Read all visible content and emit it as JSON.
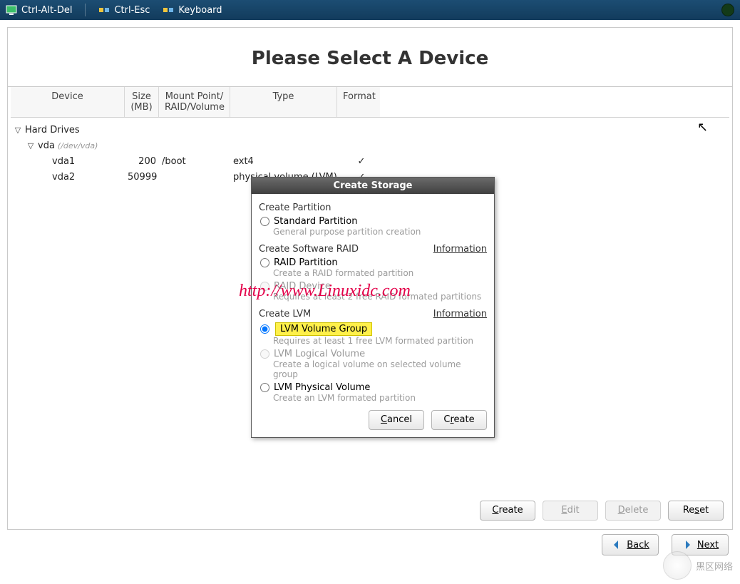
{
  "toolbar": {
    "items": [
      "Ctrl-Alt-Del",
      "Ctrl-Esc",
      "Keyboard"
    ]
  },
  "page": {
    "title": "Please Select A Device"
  },
  "columns": {
    "device": "Device",
    "size": "Size (MB)",
    "mount": "Mount Point/\nRAID/Volume",
    "type": "Type",
    "format": "Format"
  },
  "tree": {
    "hd_label": "Hard Drives",
    "vda": {
      "name": "vda",
      "dev": "(/dev/vda)"
    },
    "p1": {
      "name": "vda1",
      "size": "200",
      "mount": "/boot",
      "type": "ext4",
      "format": "✓"
    },
    "p2": {
      "name": "vda2",
      "size": "50999",
      "mount": "",
      "type": "physical volume (LVM)",
      "format": "✓"
    }
  },
  "buttons": {
    "create": "Create",
    "edit": "Edit",
    "delete": "Delete",
    "reset": "Reset",
    "back": "Back",
    "next": "Next"
  },
  "modal": {
    "title": "Create Storage",
    "sec_partition": "Create Partition",
    "std_part": "Standard Partition",
    "std_part_sub": "General purpose partition creation",
    "sec_raid": "Create Software RAID",
    "information": "Information",
    "raid_part": "RAID Partition",
    "raid_part_sub": "Create a RAID formated partition",
    "raid_dev": "RAID Device",
    "raid_dev_sub": "Requires at least 2 free RAID formated partitions",
    "sec_lvm": "Create LVM",
    "lvm_vg": "LVM Volume Group",
    "lvm_vg_sub": "Requires at least 1 free LVM formated partition",
    "lvm_lv": "LVM Logical Volume",
    "lvm_lv_sub": "Create a logical volume on selected volume group",
    "lvm_pv": "LVM Physical Volume",
    "lvm_pv_sub": "Create an LVM formated partition",
    "cancel": "Cancel",
    "create": "Create"
  },
  "watermark": "http://www.Linuxidc.com",
  "bottom_wm": "黑区网络"
}
